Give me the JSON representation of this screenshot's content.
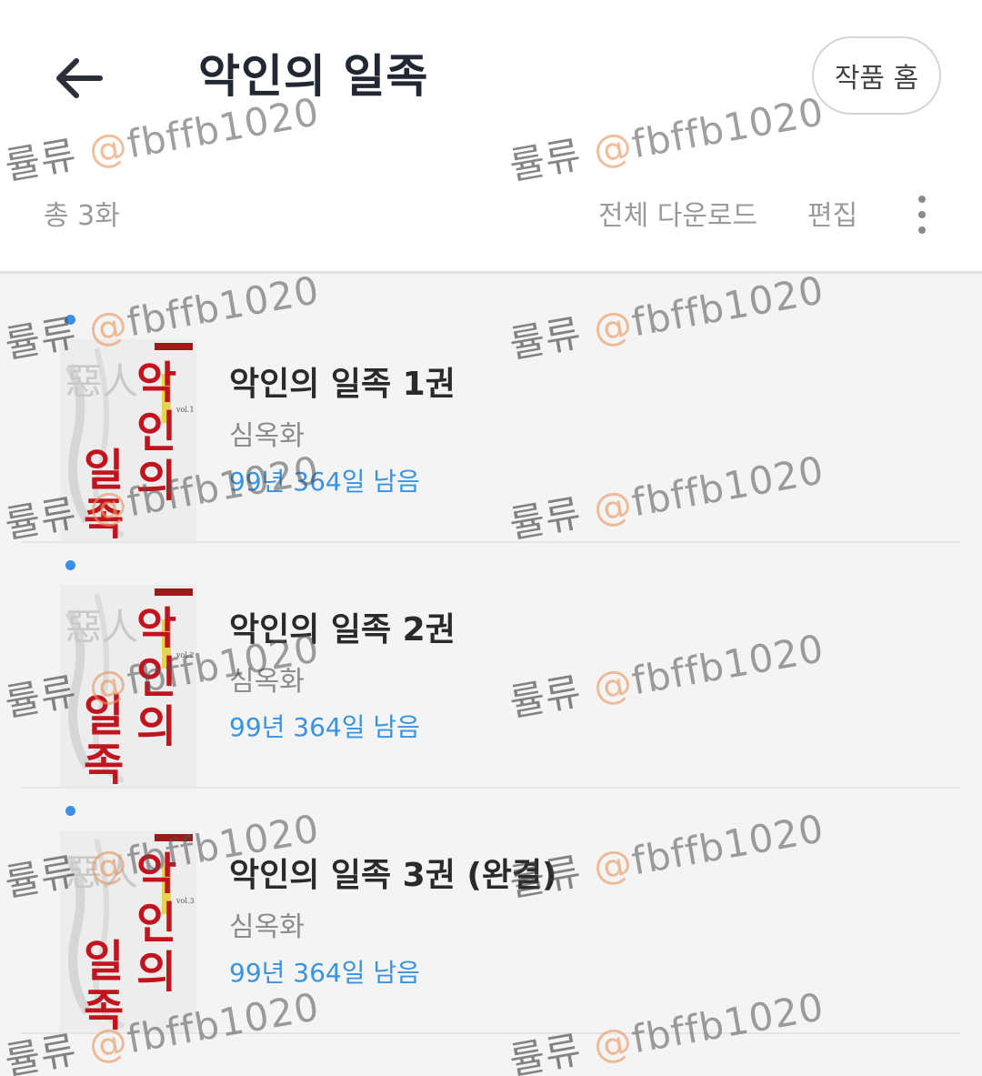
{
  "header": {
    "back_icon": "arrow-left-icon",
    "title": "악인의 일족",
    "home_label": "작품 홈"
  },
  "toolbar": {
    "total_count": "총 3화",
    "download_all_label": "전체 다운로드",
    "edit_label": "편집",
    "more_icon": "more-vertical-icon"
  },
  "colors": {
    "new_dot": "#3d8fe6",
    "remaining_text": "#3a93e0",
    "list_bg": "#f4f4f5",
    "cover_red": "#c2141f"
  },
  "volumes": [
    {
      "title": "악인의 일족 1권",
      "author": "심옥화",
      "remaining": "99년 364일 남음",
      "cover": {
        "title": "악인의 일족",
        "hanja": "惡人",
        "vol": "vol.1"
      }
    },
    {
      "title": "악인의 일족 2권",
      "author": "심옥화",
      "remaining": "99년 364일 남음",
      "cover": {
        "title": "악인의 일족",
        "hanja": "惡人",
        "vol": "vol.2"
      }
    },
    {
      "title": "악인의 일족 3권 (완결)",
      "author": "심옥화",
      "remaining": "99년 364일 남음",
      "cover": {
        "title": "악인의 일족",
        "hanja": "惡人",
        "vol": "vol.3"
      }
    }
  ],
  "watermark": {
    "name": "률류",
    "at": "@",
    "handle": "fbffb1020"
  }
}
